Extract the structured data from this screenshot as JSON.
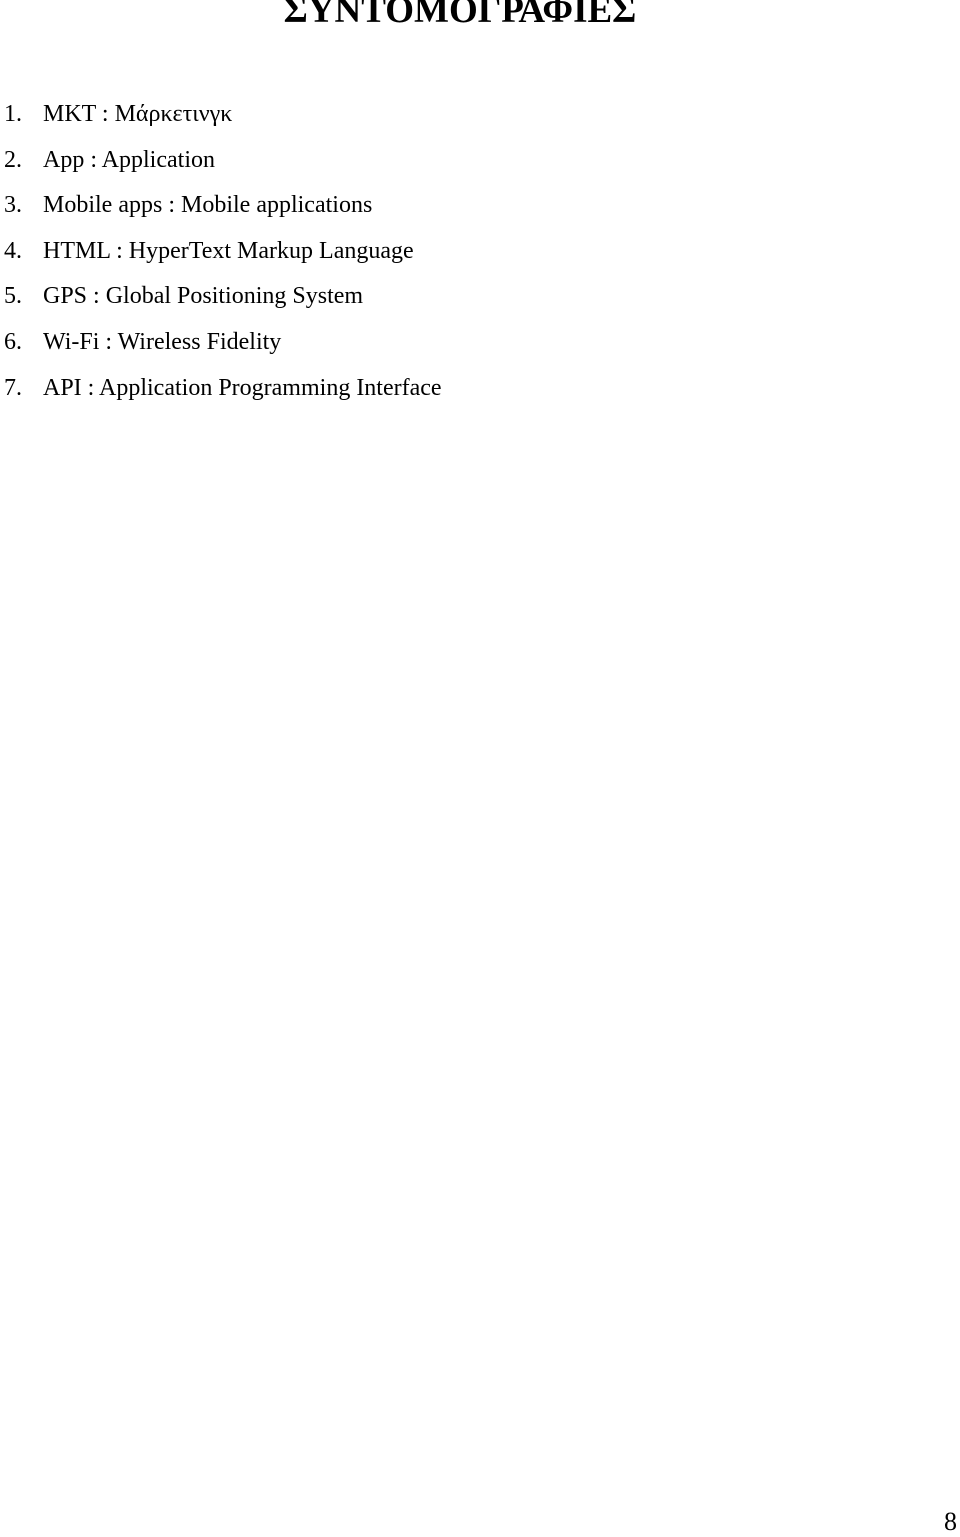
{
  "page": {
    "title": "ΣΥΝΤΟΜΟΓΡΑΦΙΕΣ",
    "abbreviations": [
      {
        "number": "1.",
        "text": "MKT : Μάρκετινγκ"
      },
      {
        "number": "2.",
        "text": "App : Application"
      },
      {
        "number": "3.",
        "text": "Mobile apps : Mobile applications"
      },
      {
        "number": "4.",
        "text": "HTML : HyperText Markup Language"
      },
      {
        "number": "5.",
        "text": "GPS : Global Positioning System"
      },
      {
        "number": "6.",
        "text": "Wi-Fi : Wireless Fidelity"
      },
      {
        "number": "7.",
        "text": "API : Application Programming Interface"
      }
    ],
    "page_number": "8"
  }
}
